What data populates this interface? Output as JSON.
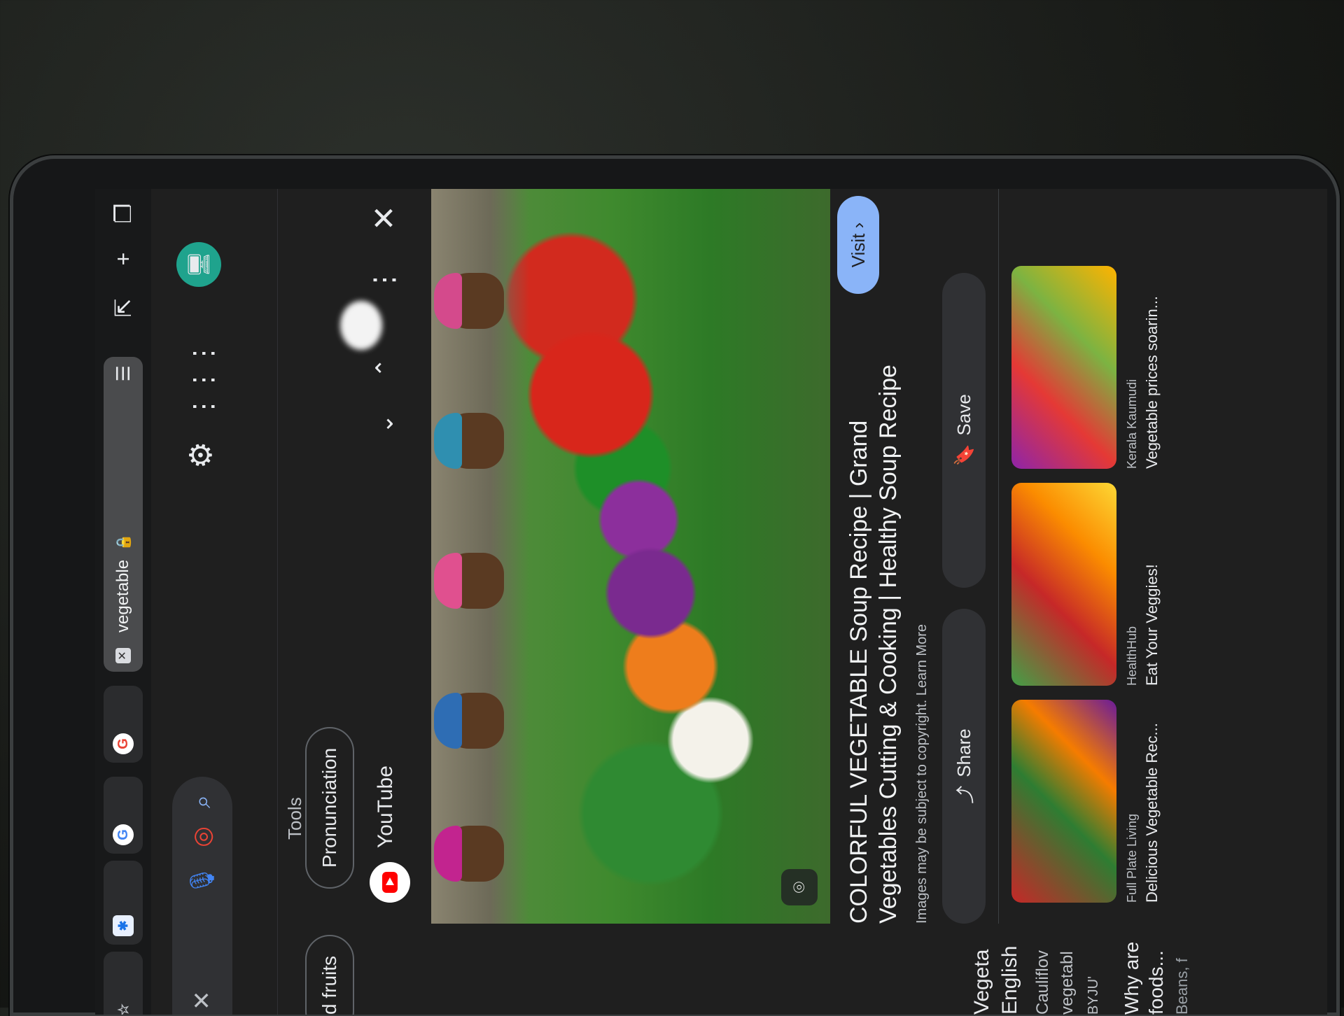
{
  "browser": {
    "tabs": [
      {
        "title": "",
        "favicon": "star"
      },
      {
        "title": "",
        "favicon": "pinwheel"
      },
      {
        "title": "",
        "favicon": "G"
      },
      {
        "title": "",
        "favicon": "G"
      },
      {
        "title": "vegetable",
        "favicon": "X",
        "active": true
      }
    ],
    "strip_icons": [
      "tab-list-icon",
      "switch-tab-icon",
      "new-tab-icon",
      "tab-overview-icon"
    ]
  },
  "search": {
    "clear_glyph": "✕",
    "tools_label": "Tools",
    "chips": [
      "d fruits",
      "Pronunciation"
    ]
  },
  "preview": {
    "source_name": "YouTube",
    "title_line1": "COLORFUL VEGETABLE Soup Recipe | Grand",
    "title_line2": "Vegetables Cutting & Cooking | Healthy Soup Recipe",
    "copyright": "Images may be subject to copyright. Learn More",
    "visit_label": "Visit",
    "share_label": "Share",
    "save_label": "Save"
  },
  "related": [
    {
      "source": "Full Plate Living",
      "title": "Delicious Vegetable Rec..."
    },
    {
      "source": "HealthHub",
      "title": "Eat Your Veggies!"
    },
    {
      "source": "Kerala Kaumudi",
      "title": "Vegetable prices soarin..."
    }
  ],
  "side_results": [
    {
      "text": "Vegeta"
    },
    {
      "text": "English"
    },
    {
      "text": "Cauliflov"
    },
    {
      "text": "vegetabl"
    },
    {
      "text": "BYJU'"
    },
    {
      "text": "Why are"
    },
    {
      "text": "foods..."
    },
    {
      "text": "Beans, f"
    }
  ],
  "colors": {
    "accent": "#8ab4f8",
    "background": "#1f1f1f",
    "youtube_red": "#ff0000",
    "avatar": "#1fa38d"
  }
}
